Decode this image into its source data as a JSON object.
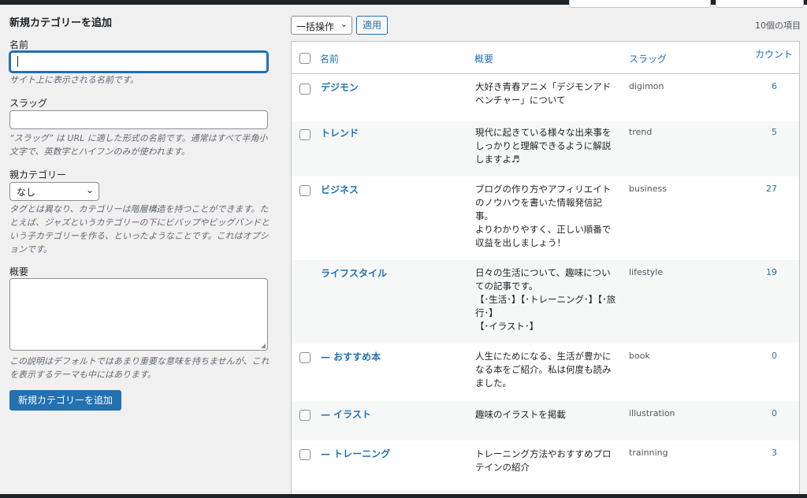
{
  "form": {
    "title": "新規カテゴリーを追加",
    "name_label": "名前",
    "name_value": "",
    "name_help": "サイト上に表示される名前です。",
    "slug_label": "スラッグ",
    "slug_value": "",
    "slug_help": "“スラッグ” は URL に適した形式の名前です。通常はすべて半角小文字で、英数字とハイフンのみが使われます。",
    "parent_label": "親カテゴリー",
    "parent_selected": "なし",
    "parent_help": "タグとは異なり、カテゴリーは階層構造を持つことができます。たとえば、ジャズというカテゴリーの下にビバップやビッグバンドという子カテゴリーを作る、といったようなことです。これはオプションです。",
    "description_label": "概要",
    "description_value": "",
    "description_help": "この説明はデフォルトではあまり重要な意味を持ちませんが、これを表示するテーマも中にはあります。",
    "submit_label": "新規カテゴリーを追加"
  },
  "toolbar": {
    "bulk_action": "一括操作",
    "apply_label": "適用",
    "item_count": "10個の項目"
  },
  "table": {
    "headers": {
      "name": "名前",
      "description": "概要",
      "slug": "スラッグ",
      "count": "カウント"
    },
    "rows": [
      {
        "name": "デジモン",
        "description": "大好き青春アニメ「デジモンアドベンチャー」について",
        "slug": "digimon",
        "count": "6"
      },
      {
        "name": "トレンド",
        "description": "現代に起きている様々な出来事をしっかりと理解できるように解説しますよ♬",
        "slug": "trend",
        "count": "5"
      },
      {
        "name": "ビジネス",
        "description": "ブログの作り方やアフィリエイトのノウハウを書いた情報発信記事。\nよりわかりやすく、正しい順番で収益を出しましょう！",
        "slug": "business",
        "count": "27"
      },
      {
        "name": "ライフスタイル",
        "description": "日々の生活について、趣味についての記事です。\n【･生活･】【･トレーニング･】【･旅行･】\n【･イラスト･】",
        "slug": "lifestyle",
        "count": "19"
      },
      {
        "name": "— おすすめ本",
        "description": "人生にためになる、生活が豊かになる本をご紹介。私は何度も読みました。",
        "slug": "book",
        "count": "0"
      },
      {
        "name": "— イラスト",
        "description": "趣味のイラストを掲載",
        "slug": "illustration",
        "count": "0"
      },
      {
        "name": "— トレーニング",
        "description": "トレーニング方法やおすすめプロテインの紹介",
        "slug": "trainning",
        "count": "3"
      }
    ]
  }
}
